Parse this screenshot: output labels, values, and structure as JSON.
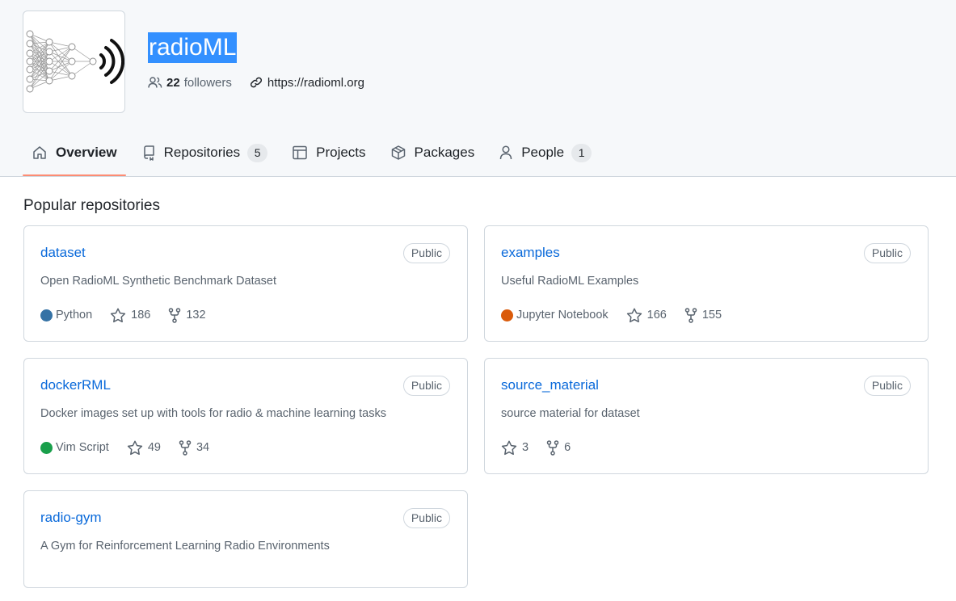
{
  "org": {
    "name": "radioML",
    "followers_count": "22",
    "followers_label": "followers",
    "website": "https://radioml.org"
  },
  "tabs": [
    {
      "label": "Overview",
      "icon": "home-icon",
      "active": true
    },
    {
      "label": "Repositories",
      "icon": "repo-icon",
      "count": "5"
    },
    {
      "label": "Projects",
      "icon": "table-icon"
    },
    {
      "label": "Packages",
      "icon": "package-icon"
    },
    {
      "label": "People",
      "icon": "person-icon",
      "count": "1"
    }
  ],
  "popular": {
    "title": "Popular repositories",
    "repos": [
      {
        "name": "dataset",
        "visibility": "Public",
        "description": "Open RadioML Synthetic Benchmark Dataset",
        "language": "Python",
        "language_color": "#3572A5",
        "stars": "186",
        "forks": "132"
      },
      {
        "name": "examples",
        "visibility": "Public",
        "description": "Useful RadioML Examples",
        "language": "Jupyter Notebook",
        "language_color": "#DA5B0B",
        "stars": "166",
        "forks": "155"
      },
      {
        "name": "dockerRML",
        "visibility": "Public",
        "description": "Docker images set up with tools for radio & machine learning tasks",
        "language": "Vim Script",
        "language_color": "#199f4b",
        "stars": "49",
        "forks": "34"
      },
      {
        "name": "source_material",
        "visibility": "Public",
        "description": "source material for dataset",
        "stars": "3",
        "forks": "6"
      },
      {
        "name": "radio-gym",
        "visibility": "Public",
        "description": "A Gym for Reinforcement Learning Radio Environments"
      }
    ]
  },
  "colors": {
    "accent": "#0969da",
    "tab_underline": "#fd8c73",
    "selection": "#3390ff"
  }
}
